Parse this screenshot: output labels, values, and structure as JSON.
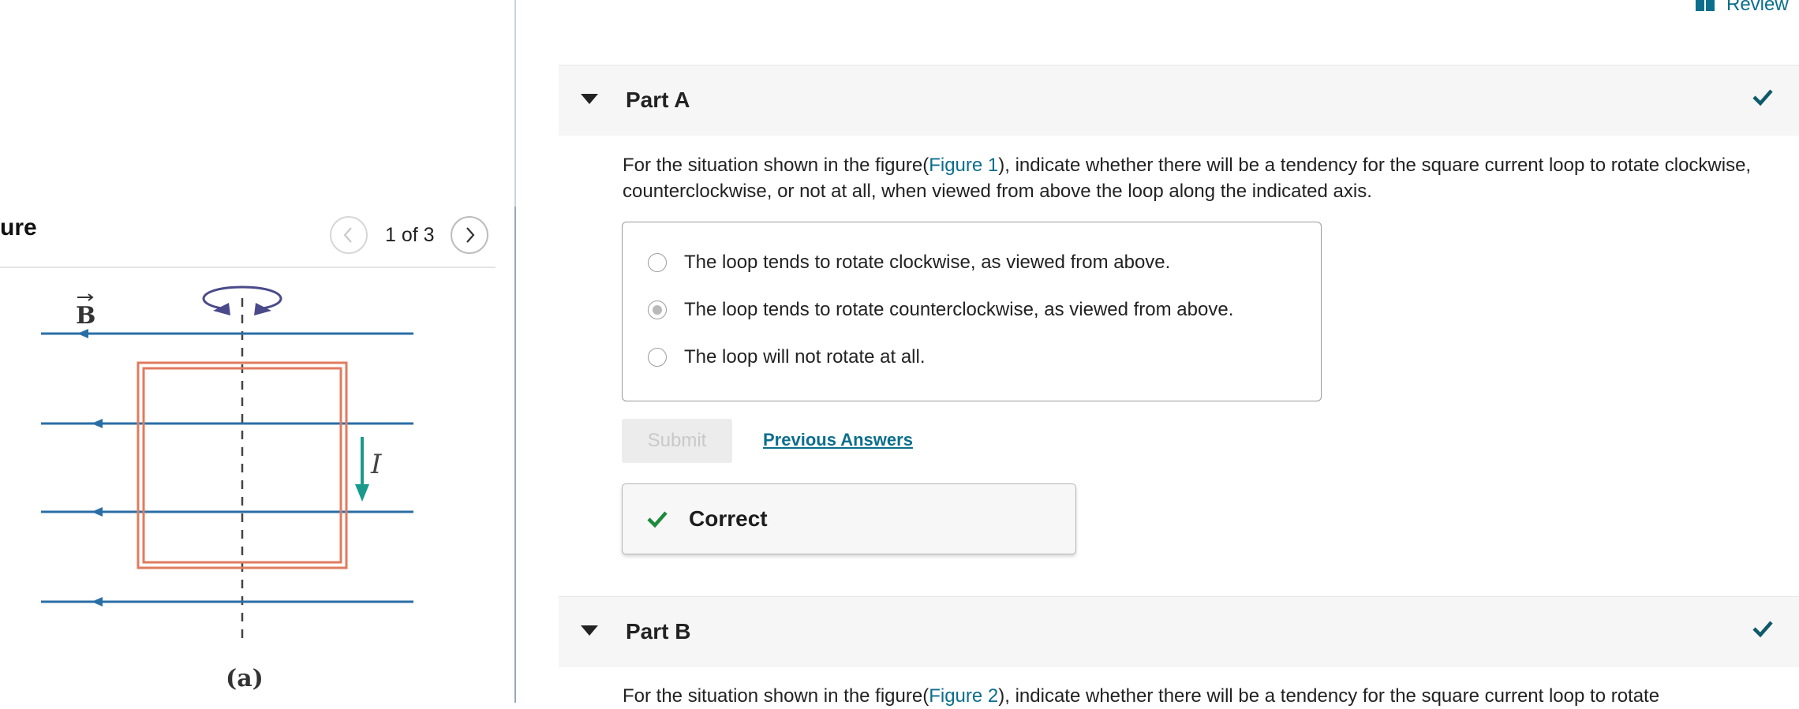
{
  "figure_panel": {
    "title": "ure",
    "counter": "1 of 3",
    "prev_icon": "chevron-left-icon",
    "next_icon": "chevron-right-icon",
    "diagram": {
      "field_label": "B",
      "current_label": "I",
      "caption": "(a)",
      "colors": {
        "field_lines": "#2a6ea6",
        "loop": "#e07b5f",
        "current_arrow": "#1a9a8c",
        "rotation_arrow": "#4a4a8a"
      }
    }
  },
  "header": {
    "review_label": "Review",
    "review_icon": "book-icon"
  },
  "part_a": {
    "title": "Part A",
    "question_before": "For the situation shown in the figure(",
    "figure_link": "Figure 1",
    "question_after": "), indicate whether there will be a tendency for the square current loop to rotate clockwise, counterclockwise, or not at all, when viewed from above the loop along the indicated axis.",
    "options": [
      {
        "label": "The loop tends to rotate clockwise, as viewed from above.",
        "selected": false
      },
      {
        "label": "The loop tends to rotate counterclockwise, as viewed from above.",
        "selected": true
      },
      {
        "label": "The loop will not rotate at all.",
        "selected": false
      }
    ],
    "submit_label": "Submit",
    "previous_answers_label": "Previous Answers",
    "feedback": "Correct"
  },
  "part_b": {
    "title": "Part B",
    "question_before": "For the situation shown in the figure(",
    "figure_link": "Figure 2",
    "question_after": "), indicate whether there will be a tendency for the square current loop to rotate"
  },
  "colors": {
    "accent": "#0b6e8d",
    "check_teal": "#0e5a6b",
    "correct_green": "#1f8a3c"
  }
}
